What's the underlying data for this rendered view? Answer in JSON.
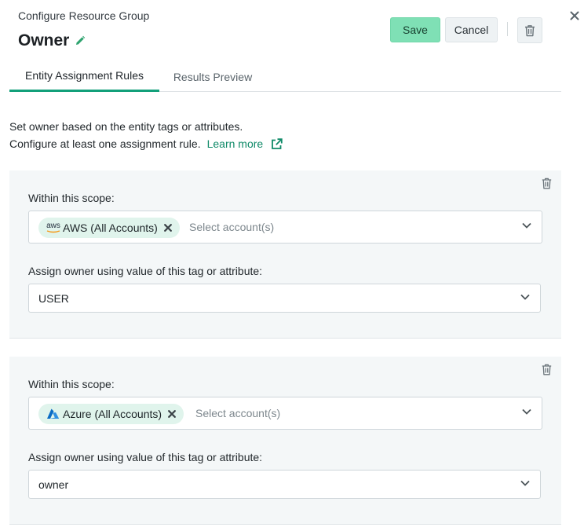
{
  "header": {
    "subtitle": "Configure Resource Group",
    "title": "Owner",
    "save_label": "Save",
    "cancel_label": "Cancel"
  },
  "tabs": [
    {
      "label": "Entity Assignment Rules",
      "active": true
    },
    {
      "label": "Results Preview",
      "active": false
    }
  ],
  "description": {
    "line1": "Set owner based on the entity tags or attributes.",
    "line2": "Configure at least one assignment rule.",
    "learn_more": "Learn more"
  },
  "rules": [
    {
      "scope_label": "Within this scope:",
      "chip_label": "AWS (All Accounts)",
      "chip_icon": "aws-logo-icon",
      "scope_placeholder": "Select account(s)",
      "attr_label": "Assign owner using value of this tag or attribute:",
      "attr_value": "USER"
    },
    {
      "scope_label": "Within this scope:",
      "chip_label": "Azure (All Accounts)",
      "chip_icon": "azure-logo-icon",
      "scope_placeholder": "Select account(s)",
      "attr_label": "Assign owner using value of this tag or attribute:",
      "attr_value": "owner"
    }
  ],
  "aws_logo_text": "aws",
  "colors": {
    "accent": "#13a07a",
    "link": "#0f8a68",
    "save_bg": "#7fe0b5",
    "panel_bg": "#f4f7f8",
    "chip_bg": "#e0f4ec"
  }
}
